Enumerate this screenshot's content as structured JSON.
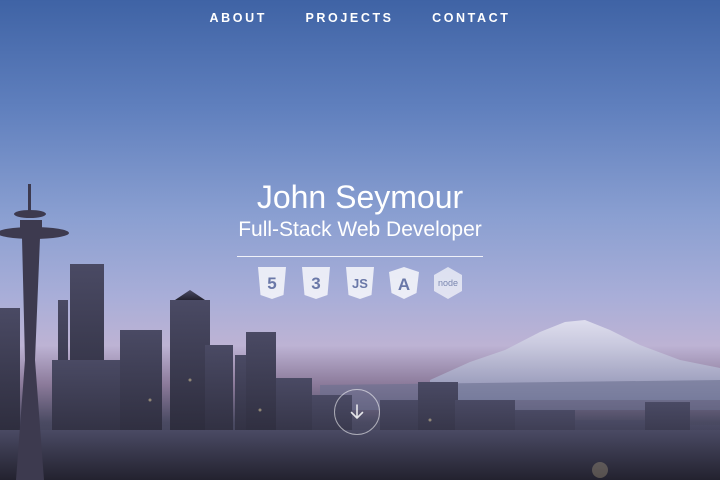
{
  "nav": {
    "items": [
      {
        "label": "ABOUT"
      },
      {
        "label": "PROJECTS"
      },
      {
        "label": "CONTACT"
      }
    ]
  },
  "hero": {
    "name": "John Seymour",
    "role": "Full-Stack Web Developer"
  },
  "tech_icons": [
    {
      "icon": "html5-icon",
      "glyph": "5"
    },
    {
      "icon": "css3-icon",
      "glyph": "3"
    },
    {
      "icon": "javascript-icon",
      "glyph": "JS"
    },
    {
      "icon": "angular-icon",
      "glyph": "A"
    },
    {
      "icon": "nodejs-icon",
      "glyph": "node"
    }
  ],
  "scroll_button": {
    "icon": "arrow-down-icon"
  },
  "colors": {
    "text": "#ffffff",
    "sky_top": "#3f63a5",
    "sky_horizon": "#bdb3d4"
  }
}
